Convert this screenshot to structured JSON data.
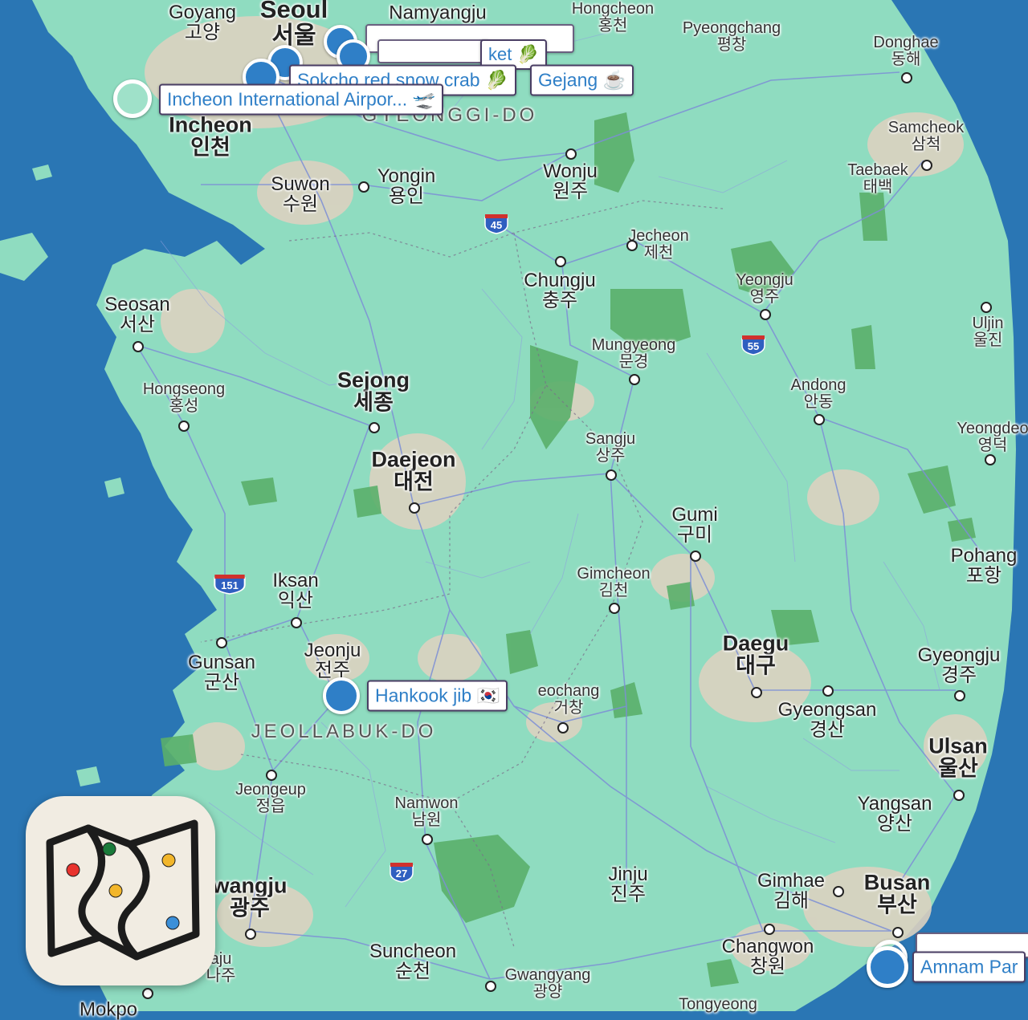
{
  "map": {
    "region_labels": [
      {
        "id": "gyeonggi",
        "text": "GYEONGGI-DO"
      },
      {
        "id": "jeollabuk",
        "text": "JEOLLABUK-DO"
      }
    ],
    "cities": [
      {
        "id": "goyang",
        "en": "Goyang",
        "ko": "고양",
        "size": "m"
      },
      {
        "id": "seoul",
        "en": "Seoul",
        "ko": "서울",
        "size": "xl"
      },
      {
        "id": "namyangju",
        "en": "Namyangju",
        "ko": "",
        "size": "m"
      },
      {
        "id": "hongcheon",
        "en": "Hongcheon",
        "ko": "홍천",
        "size": "s"
      },
      {
        "id": "pyeongchang",
        "en": "Pyeongchang",
        "ko": "평창",
        "size": "s"
      },
      {
        "id": "donghae",
        "en": "Donghae",
        "ko": "동해",
        "size": "s"
      },
      {
        "id": "incheon",
        "en": "Incheon",
        "ko": "인천",
        "size": "l"
      },
      {
        "id": "samcheok",
        "en": "Samcheok",
        "ko": "삼척",
        "size": "s"
      },
      {
        "id": "taebaek",
        "en": "Taebaek",
        "ko": "태백",
        "size": "s"
      },
      {
        "id": "suwon",
        "en": "Suwon",
        "ko": "수원",
        "size": "m"
      },
      {
        "id": "yongin",
        "en": "Yongin",
        "ko": "용인",
        "size": "m"
      },
      {
        "id": "wonju",
        "en": "Wonju",
        "ko": "원주",
        "size": "m"
      },
      {
        "id": "jecheon",
        "en": "Jecheon",
        "ko": "제천",
        "size": "s"
      },
      {
        "id": "chungju",
        "en": "Chungju",
        "ko": "충주",
        "size": "m"
      },
      {
        "id": "yeongju",
        "en": "Yeongju",
        "ko": "영주",
        "size": "s"
      },
      {
        "id": "seosan",
        "en": "Seosan",
        "ko": "서산",
        "size": "m"
      },
      {
        "id": "uljin",
        "en": "Uljin",
        "ko": "울진",
        "size": "s"
      },
      {
        "id": "mungyeong",
        "en": "Mungyeong",
        "ko": "문경",
        "size": "s"
      },
      {
        "id": "sejong",
        "en": "Sejong",
        "ko": "세종",
        "size": "l"
      },
      {
        "id": "hongseong",
        "en": "Hongseong",
        "ko": "홍성",
        "size": "s"
      },
      {
        "id": "andong",
        "en": "Andong",
        "ko": "안동",
        "size": "s"
      },
      {
        "id": "yeongdeok",
        "en": "Yeongdeo",
        "ko": "영덕",
        "size": "s"
      },
      {
        "id": "sangju",
        "en": "Sangju",
        "ko": "상주",
        "size": "s"
      },
      {
        "id": "daejeon",
        "en": "Daejeon",
        "ko": "대전",
        "size": "l"
      },
      {
        "id": "gumi",
        "en": "Gumi",
        "ko": "구미",
        "size": "m"
      },
      {
        "id": "pohang",
        "en": "Pohang",
        "ko": "포항",
        "size": "m"
      },
      {
        "id": "iksan",
        "en": "Iksan",
        "ko": "익산",
        "size": "m"
      },
      {
        "id": "gimcheon",
        "en": "Gimcheon",
        "ko": "김천",
        "size": "s"
      },
      {
        "id": "jeonju",
        "en": "Jeonju",
        "ko": "전주",
        "size": "m"
      },
      {
        "id": "gunsan",
        "en": "Gunsan",
        "ko": "군산",
        "size": "m"
      },
      {
        "id": "daegu",
        "en": "Daegu",
        "ko": "대구",
        "size": "l"
      },
      {
        "id": "gyeongju",
        "en": "Gyeongju",
        "ko": "경주",
        "size": "m"
      },
      {
        "id": "geochang",
        "en": "eochang",
        "ko": "거창",
        "size": "s"
      },
      {
        "id": "gyeongsan",
        "en": "Gyeongsan",
        "ko": "경산",
        "size": "m"
      },
      {
        "id": "ulsan",
        "en": "Ulsan",
        "ko": "울산",
        "size": "l"
      },
      {
        "id": "jeongeup",
        "en": "Jeongeup",
        "ko": "정읍",
        "size": "s"
      },
      {
        "id": "namwon",
        "en": "Namwon",
        "ko": "남원",
        "size": "s"
      },
      {
        "id": "yangsan",
        "en": "Yangsan",
        "ko": "양산",
        "size": "m"
      },
      {
        "id": "gwangju",
        "en": "wangju",
        "ko": "광주",
        "size": "l"
      },
      {
        "id": "jinju",
        "en": "Jinju",
        "ko": "진주",
        "size": "m"
      },
      {
        "id": "gimhae",
        "en": "Gimhae",
        "ko": "김해",
        "size": "m"
      },
      {
        "id": "busan",
        "en": "Busan",
        "ko": "부산",
        "size": "l"
      },
      {
        "id": "suncheon",
        "en": "Suncheon",
        "ko": "순천",
        "size": "m"
      },
      {
        "id": "changwon",
        "en": "Changwon",
        "ko": "창원",
        "size": "m"
      },
      {
        "id": "naju",
        "en": "aju",
        "ko": "나주",
        "size": "s"
      },
      {
        "id": "gwangyang",
        "en": "Gwangyang",
        "ko": "광양",
        "size": "s"
      },
      {
        "id": "tongyeong",
        "en": "Tongyeong",
        "ko": "",
        "size": "s"
      },
      {
        "id": "mokpo",
        "en": "Mokpo",
        "ko": "",
        "size": "m"
      }
    ],
    "highway_shields": [
      {
        "id": "h45",
        "number": "45"
      },
      {
        "id": "h55",
        "number": "55"
      },
      {
        "id": "h151",
        "number": "151"
      },
      {
        "id": "h27",
        "number": "27"
      }
    ],
    "colors": {
      "sea": "#2a76b4",
      "land": "#8fdcc0",
      "forest": "#5aaf6a",
      "urban": "#dcd2c0",
      "road": "#7d8fd6",
      "pin": "#2f7fc7",
      "label_border": "#4a3e64"
    }
  },
  "markers": [
    {
      "id": "incheon-airport",
      "label": "Incheon International Airpor...",
      "icon": "🛫",
      "type": "hollow"
    },
    {
      "id": "sokcho-crab",
      "label": "Sokcho red snow crab",
      "icon": "🥬",
      "type": "filled"
    },
    {
      "id": "gejang",
      "label": "Gejang",
      "icon": "☕",
      "type": "filled"
    },
    {
      "id": "market",
      "label": "ket",
      "icon": "🥬",
      "type": "filled"
    },
    {
      "id": "stack-a",
      "label": "",
      "icon": "",
      "type": "filled"
    },
    {
      "id": "stack-b",
      "label": "",
      "icon": "",
      "type": "filled"
    },
    {
      "id": "hankook-jib",
      "label": "Hankook jib",
      "icon": "🇰🇷",
      "type": "filled"
    },
    {
      "id": "amnam-park",
      "label": "Amnam Par",
      "icon": "",
      "type": "hollow"
    }
  ],
  "app_icon": {
    "name": "map-app-icon",
    "pin_colors": [
      "#e8332e",
      "#1a7a3a",
      "#f2b62b",
      "#f2b62b",
      "#3b8fd8"
    ]
  }
}
